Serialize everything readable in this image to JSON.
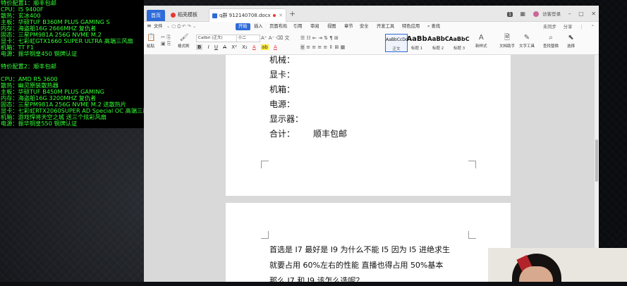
{
  "overlay": {
    "lines": [
      "特价配置1：顺丰包邮",
      "CPU：I5 9400F",
      "散热：玄冰400",
      "主板：华硕TUF B360M PLUS GAMING S",
      "内存：海盗船16G 2666MHZ 复仇者",
      "固态：三星PM981A 256G NVME M.2",
      "显卡：七彩虹GTX1660 SUPER ULTRA 高端三风扇",
      "机箱：TT F1",
      "电源：振华铜皇450 铜牌认证",
      "",
      "特价配置2：顺丰包邮",
      "",
      "CPU：AMD R5 3600",
      "散热：幽灵原装散热器",
      "主板：华硕TUF B450M PLUS GAMING",
      "内存：海盗船16G 3200MHZ 复仇者",
      "固态：三星PM981A 256G NVME M.2 送散热片",
      "显卡：七彩虹RTX2060SUPER AD Special OC 高端三风扇",
      "机箱：游戏悍将天空之城 送三个炫彩风扇",
      "电源：振华铜皇550 铜牌认证"
    ]
  },
  "tabs": {
    "home": "首页",
    "template": "稻壳模板",
    "document": "q群 912140708.docx",
    "add": "+"
  },
  "titlebar": {
    "badge": "1",
    "icons": [
      "grid-icon",
      "user-icon",
      "minimize-icon",
      "maximize-icon",
      "close-icon"
    ],
    "login": "访客登录"
  },
  "menu": {
    "items": [
      "文件",
      "开始",
      "插入",
      "页面布局",
      "引用",
      "审阅",
      "视图",
      "章节",
      "安全",
      "开发工具",
      "特色应用"
    ],
    "search": "查找",
    "right": [
      "未同步",
      "分享"
    ]
  },
  "ribbon": {
    "paste": "粘贴",
    "format_painter": "格式刷",
    "font_name": "Calibri (正文)",
    "font_size": "小二",
    "styles": [
      {
        "preview": "AaBbCcDd",
        "label": "正文"
      },
      {
        "preview": "AaBb",
        "label": "标题 1"
      },
      {
        "preview": "AaBbC",
        "label": "标题 2"
      },
      {
        "preview": "AaBbC",
        "label": "标题 3"
      }
    ],
    "new_style": "新样式",
    "doc_helper": "文档助手",
    "text_tools": "文字工具",
    "find_replace": "查找替换",
    "select": "选择"
  },
  "page1": {
    "lines": [
      "机械：",
      "显卡：",
      "机箱：",
      "电源：",
      "显示器："
    ],
    "total_label": "合计：",
    "total_value": "顺丰包邮"
  },
  "page2": {
    "lines": [
      "首选是 I7  最好是 I9  为什么不能 I5  因为 I5  进绝求生",
      "就要占用 60%左右的性能  直播也得占用 50%基本",
      "那么 I7  和 I9  该怎么选呢？"
    ]
  }
}
